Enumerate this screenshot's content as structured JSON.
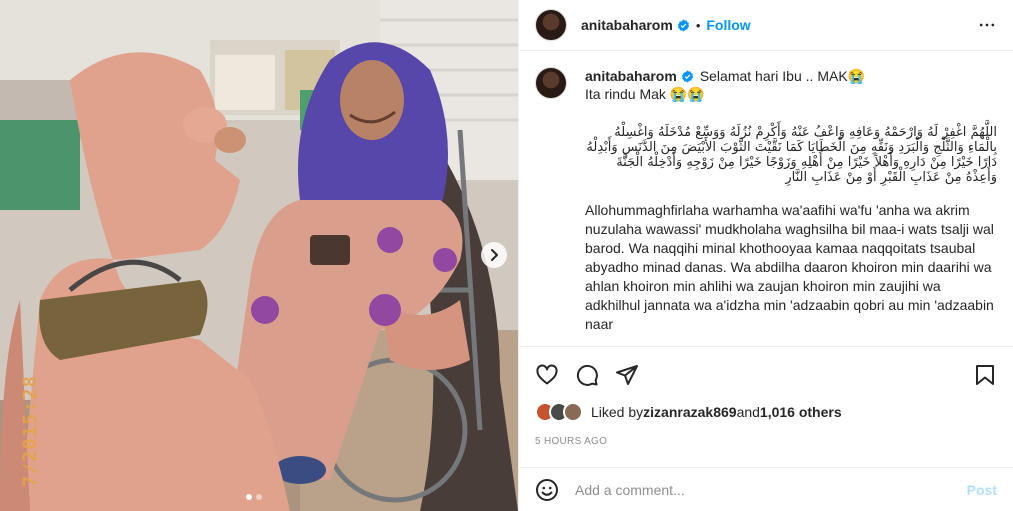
{
  "post": {
    "username": "anitabaharom",
    "follow_label": "Follow",
    "dot": "•",
    "caption_line1": "Selamat hari Ibu .. MAK😭",
    "caption_line2": "Ita rindu Mak 😭😭",
    "arabic_text": "اللَّهُمَّ اغْفِرْ لَهُ وَارْحَمْهُ وَعَافِهِ وَاعْفُ عَنْهُ وَأَكْرِمْ نُزُلَهُ وَوَسِّعْ مُدْخَلَهُ وَاغْسِلْهُ بِالْمَاءِ وَالثَّلْجِ وَالْبَرَدِ وَنَقِّهِ مِنَ الْخَطَايَا كَمَا نَقَّيْتَ الثَّوْبَ الأَبْيَضَ مِنَ الدَّنَسِ وَأَبْدِلْهُ دَارًا خَيْرًا مِنْ دَارِهِ وَأَهْلاً خَيْرًا مِنْ أَهْلِهِ وَزَوْجًا خَيْرًا مِنْ زَوْجِهِ وَأَدْخِلْهُ الْجَنَّةَ وَأَعِذْهُ مِنْ عَذَابِ الْقَبْرِ أَوْ مِنْ عَذَابِ النَّارِ",
    "latin_text": "Allohummaghfirlaha warhamha wa'aafihi wa'fu 'anha wa akrim nuzulaha wawassi' mudkholaha waghsilha bil maa-i wats tsalji wal barod. Wa naqqihi minal khothooyaa kamaa naqqoitats tsaubal abyadho minad danas. Wa abdilha daaron khoiron min daarihi wa ahlan khoiron min ahlihi wa zaujan khoiron min zaujihi wa adkhilhul jannata wa a'idzha min 'adzaabin qobri au min 'adzaabin naar",
    "photo_date_stamp": "7/2015:28",
    "carousel_index": 0,
    "carousel_count": 2
  },
  "likes": {
    "prefix": "Liked by ",
    "user": "zizanrazak869",
    "and": " and ",
    "others": "1,016 others"
  },
  "time_ago": "5 HOURS AGO",
  "comment": {
    "placeholder": "Add a comment...",
    "post_label": "Post"
  },
  "icons": {
    "verified": "verified-badge-icon",
    "more": "more-options-icon",
    "like": "heart-icon",
    "comment": "comment-icon",
    "share": "share-icon",
    "save": "bookmark-icon",
    "emoji": "emoji-icon",
    "next": "chevron-right-icon"
  },
  "colors": {
    "accent": "#0095f6",
    "verified": "#0095f6",
    "post_disabled": "#b2dffc",
    "muted": "#8e8e8e"
  }
}
